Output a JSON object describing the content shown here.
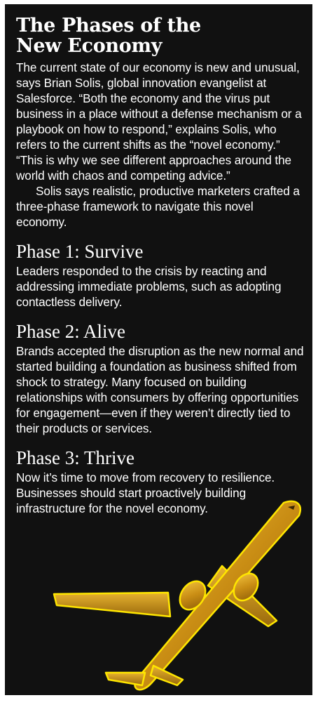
{
  "article": {
    "title_line1": "The Phases of the",
    "title_line2": "New Economy",
    "intro": "The current state of our economy is new and unusual, says Brian Solis, global innovation evangelist at Salesforce. “Both the economy and the virus put business in a place without a defense mechanism or a playbook on how to respond,” explains Solis, who refers to the current shifts as the “novel economy.” “This is why we see different approaches around the world with chaos and competing advice.”",
    "framework": "Solis says realistic, productive marketers crafted a three-phase framework to navigate this novel economy."
  },
  "phases": [
    {
      "heading": "Phase 1: Survive",
      "body": "Leaders responded to the crisis by reacting and addressing immediate problems, such as adopting contactless delivery."
    },
    {
      "heading": "Phase 2: Alive",
      "body": "Brands accepted the disruption as the new normal and started building a foundation as business shifted from shock to strategy. Many focused on building relationships with consumers by offering opportunities for engagement—even if they weren’t directly tied to their products or services."
    },
    {
      "heading": "Phase 3: Thrive",
      "body": "Now it’s time to move from recovery to resilience. Businesses should start proactively building infrastructure for the novel economy."
    }
  ],
  "colors": {
    "background": "#111111",
    "text": "#ffffff",
    "plane_gold": "#d4a12a",
    "plane_glow": "#ffe600"
  },
  "illustration": {
    "icon": "airplane-icon"
  }
}
